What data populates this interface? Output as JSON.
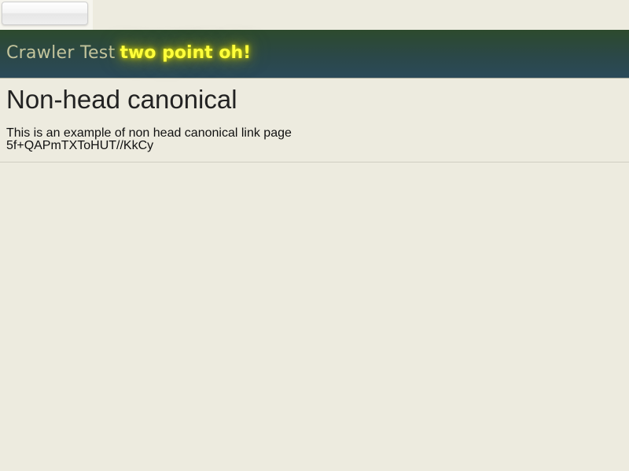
{
  "header": {
    "title_main": "Crawler Test",
    "title_sub": "two point oh!"
  },
  "main": {
    "heading": "Non-head canonical",
    "description": "This is an example of non head canonical link page",
    "hash": "5f+QAPmTXToHUT//KkCy"
  },
  "colors": {
    "background": "#edebdf",
    "banner_title": "#c3c49c",
    "banner_sub": "#ffff3a"
  }
}
